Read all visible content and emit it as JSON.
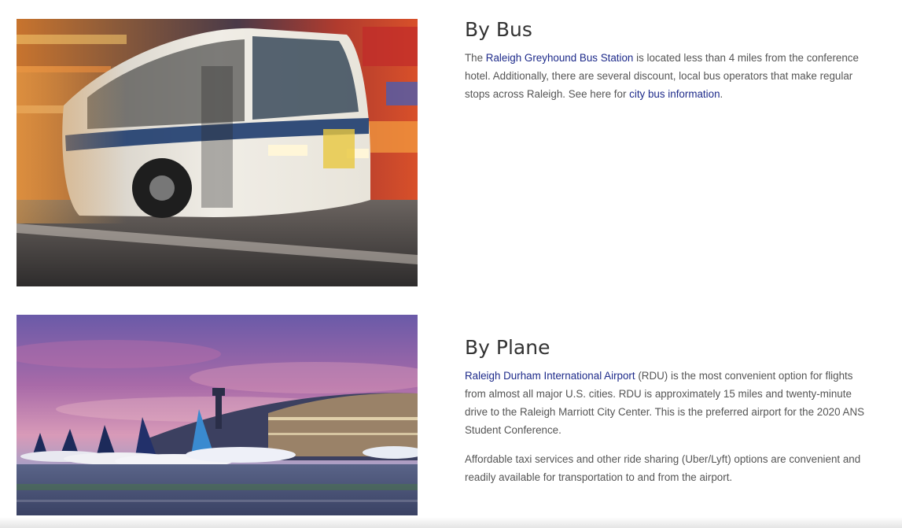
{
  "bus": {
    "heading": "By Bus",
    "text_1": "The ",
    "link_station": "Raleigh Greyhound Bus Station",
    "text_2": " is located less than 4 miles from the conference hotel. Additionally, there are several discount, local bus operators that make regular stops across Raleigh.  See here for ",
    "link_city_bus": "city bus information",
    "text_3": ".",
    "image": "bus-photo"
  },
  "plane": {
    "heading": "By Plane",
    "link_airport": "Raleigh Durham International Airport",
    "text_1": " (RDU) is the most convenient option for flights from almost all major U.S. cities. RDU is approximately 15 miles and twenty-minute drive to the Raleigh Marriott City Center. This is the preferred airport for the 2020 ANS Student Conference.",
    "paragraph_2": "Affordable taxi services and other ride sharing (Uber/Lyft) options are convenient and readily available for transportation to and from the airport.",
    "image": "airport-photo"
  },
  "colors": {
    "link": "#1d2a8a",
    "heading": "#333333",
    "body_text": "#555555"
  }
}
